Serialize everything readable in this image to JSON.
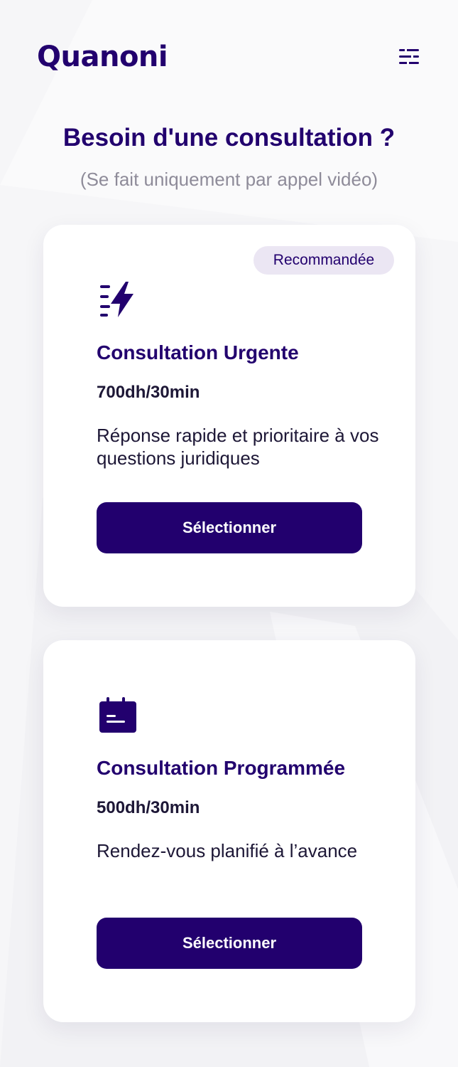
{
  "app": {
    "brand": "Quanoni",
    "menu_icon": "menu-icon"
  },
  "colors": {
    "brand": "#22006e",
    "badge_bg": "#ebe6f3",
    "subtitle": "#8e8b99",
    "text": "#1d1736",
    "background": "#f6f6f8",
    "card": "#ffffff"
  },
  "hero": {
    "title": "Besoin d'une consultation ?",
    "subtitle": "(Se fait uniquement par appel vidéo)"
  },
  "cards": [
    {
      "badge": "Recommandée",
      "icon": "lightning-icon",
      "title": "Consultation Urgente",
      "price": "700dh/30min",
      "description": "Réponse rapide et prioritaire à vos questions juridiques",
      "button_label": "Sélectionner"
    },
    {
      "icon": "calendar-icon",
      "title": "Consultation Programmée",
      "price": "500dh/30min",
      "description": "Rendez-vous planifié à l’avance",
      "button_label": "Sélectionner"
    }
  ]
}
